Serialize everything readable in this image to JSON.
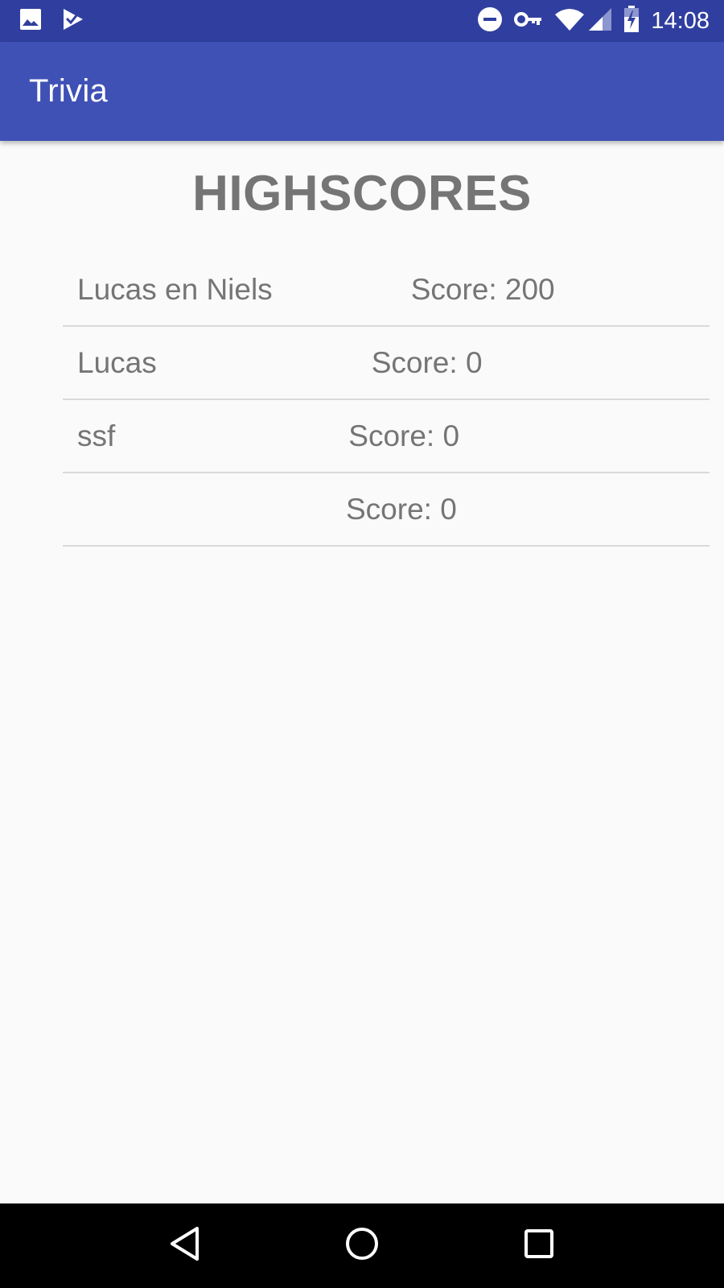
{
  "status_bar": {
    "time": "14:08",
    "left_icons": [
      "image-icon",
      "check-app-icon"
    ],
    "right_icons": [
      "do-not-disturb-icon",
      "vpn-key-icon",
      "wifi-icon",
      "signal-icon",
      "battery-icon"
    ]
  },
  "app_bar": {
    "title": "Trivia",
    "color": "#3f51b5",
    "status_color": "#303f9f"
  },
  "main": {
    "heading": "HIGHSCORES",
    "scores": [
      {
        "name": "Lucas en Niels",
        "score": "Score: 200"
      },
      {
        "name": "Lucas",
        "score": "Score: 0"
      },
      {
        "name": "ssf",
        "score": "Score: 0"
      },
      {
        "name": "",
        "score": "Score: 0"
      }
    ]
  },
  "nav_bar": {
    "buttons": [
      "back-icon",
      "home-icon",
      "recents-icon"
    ]
  }
}
